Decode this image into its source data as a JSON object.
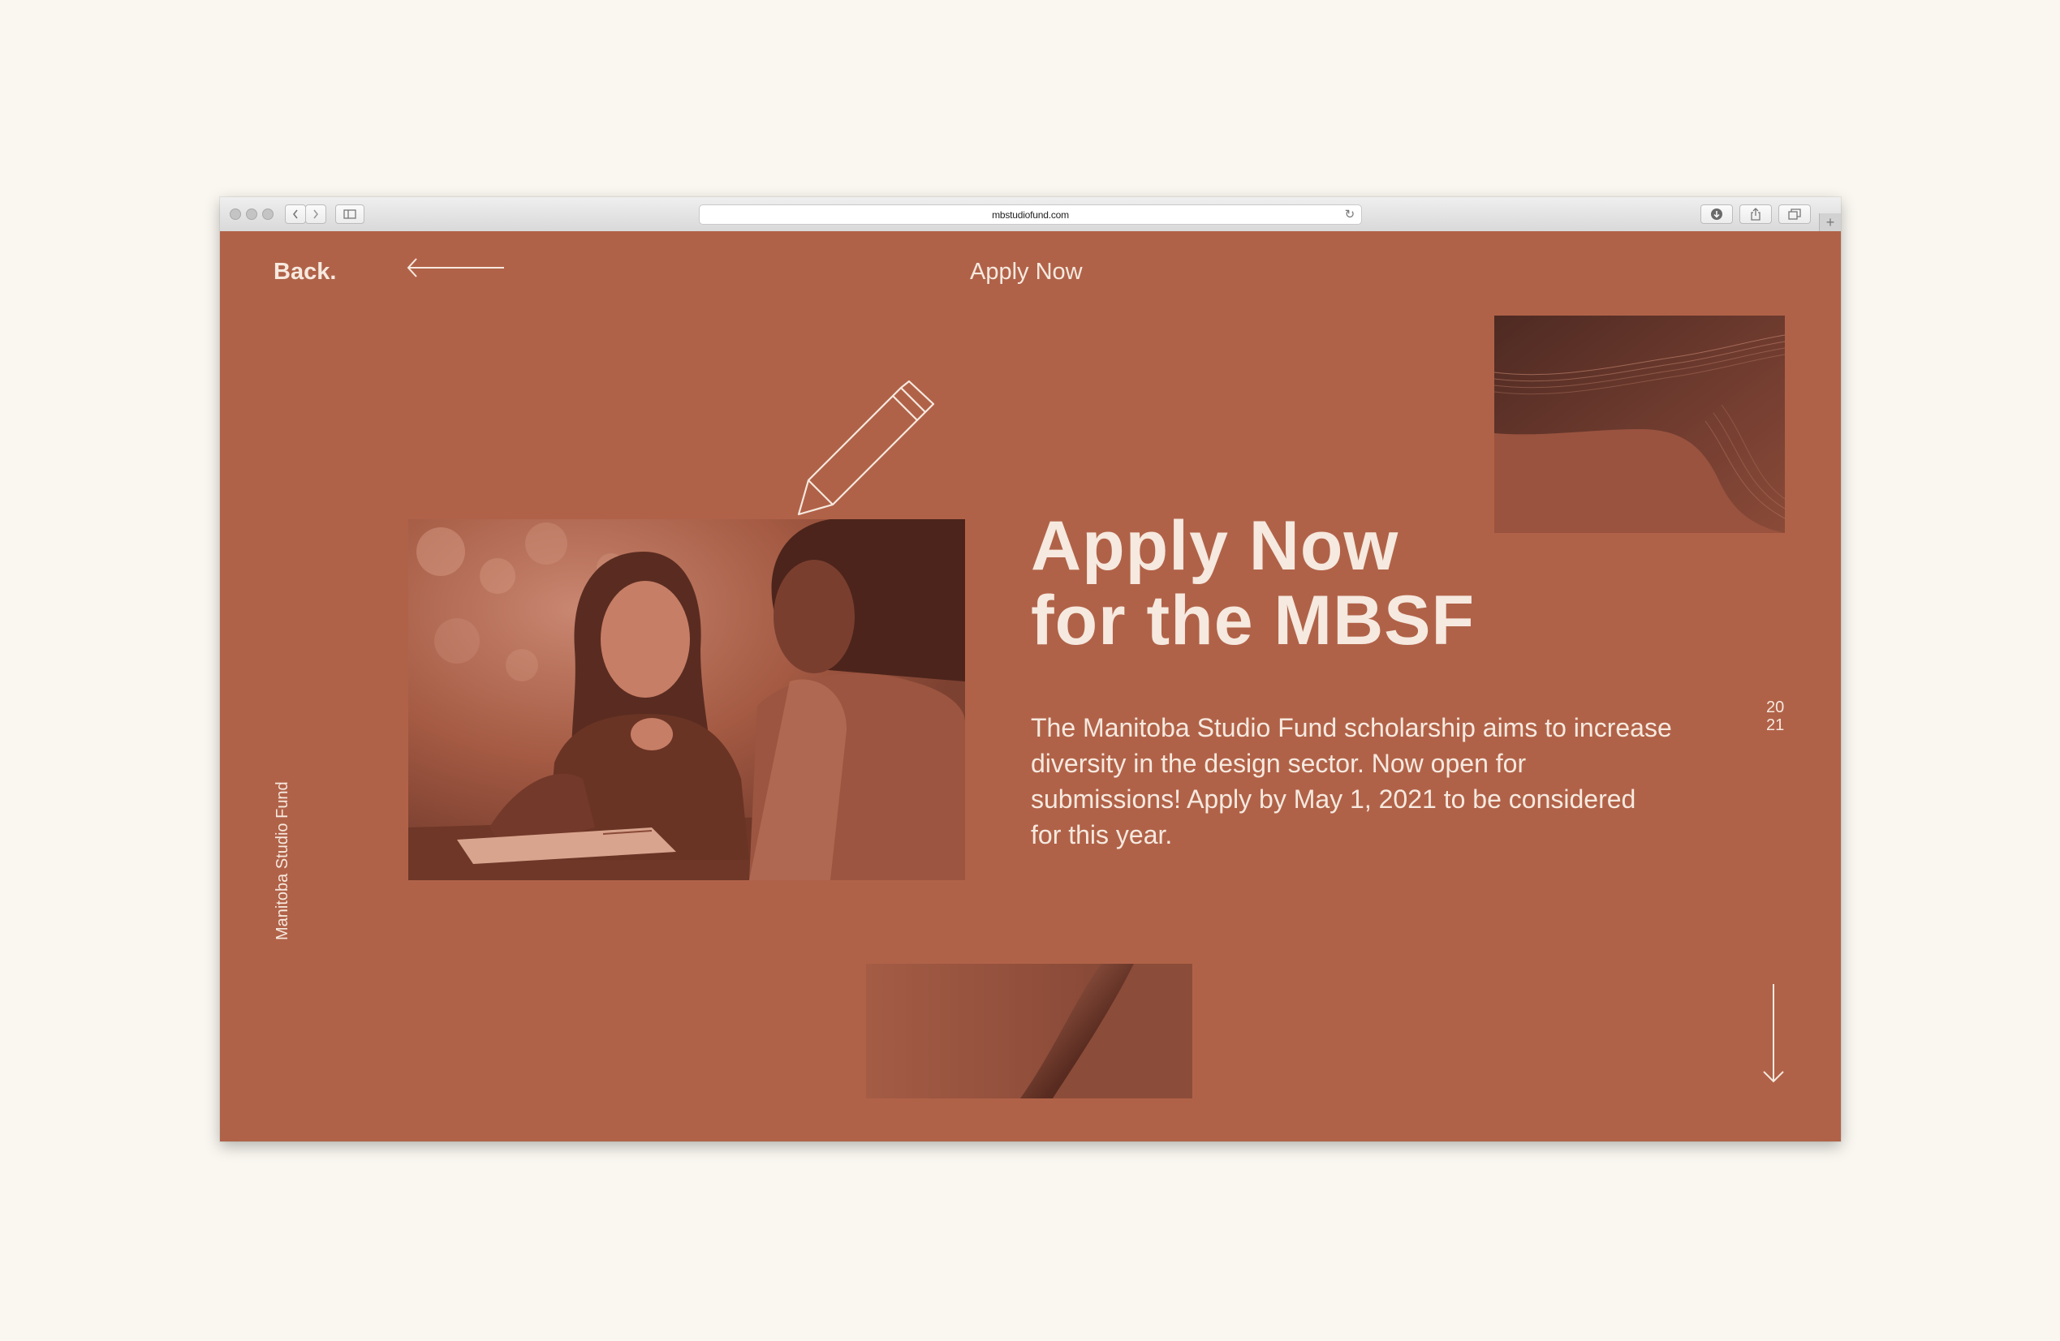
{
  "browser": {
    "url": "mbstudiofund.com"
  },
  "nav": {
    "back_label": "Back.",
    "title": "Apply Now"
  },
  "hero": {
    "title_line1": "Apply Now",
    "title_line2": "for the MBSF",
    "body": "The Manitoba Studio Fund scholarship aims to increase diversity in the design sector. Now open for submissions! Apply by May 1, 2021 to be considered for this year."
  },
  "side": {
    "year_top": "20",
    "year_bottom": "21",
    "brand_vertical": "Manitoba Studio Fund"
  },
  "colors": {
    "page_bg": "#b06248",
    "text_light": "#f6e9df",
    "outer_bg": "#faf7f1"
  },
  "icons": {
    "back_arrow": "arrow-left-icon",
    "pencil": "pencil-icon",
    "scroll": "arrow-down-icon"
  }
}
